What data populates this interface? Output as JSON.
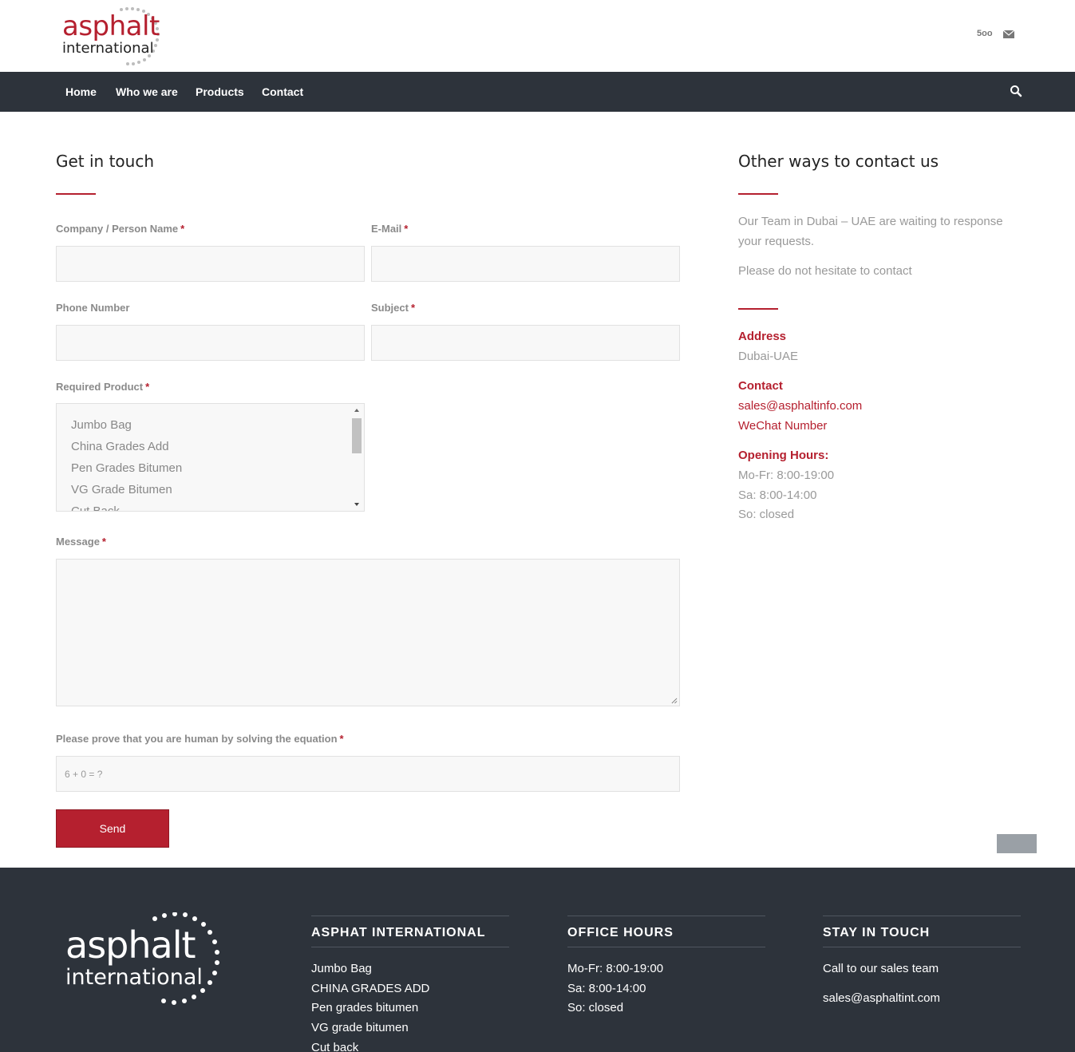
{
  "header": {
    "logo": {
      "word1": "asphalt",
      "word2": "international"
    },
    "social": {
      "icon1": "500px-icon",
      "icon1_text": "5oo",
      "icon2": "mail-icon"
    }
  },
  "nav": {
    "items": [
      "Home",
      "Who we are",
      "Products",
      "Contact"
    ],
    "search_icon": "search-icon"
  },
  "form": {
    "title": "Get in touch",
    "labels": {
      "name": "Company / Person Name",
      "email": "E-Mail",
      "phone": "Phone Number",
      "subject": "Subject",
      "product": "Required Product",
      "message": "Message",
      "captcha": "Please prove that you are human by solving the equation"
    },
    "required_mark": "*",
    "values": {
      "name": "",
      "email": "",
      "phone": "",
      "subject": "",
      "message": ""
    },
    "product_options": [
      "Jumbo Bag",
      "China Grades Add",
      "Pen Grades Bitumen",
      "VG Grade Bitumen",
      "Cut Back"
    ],
    "captcha_placeholder": "6 + 0 = ?",
    "send_label": "Send"
  },
  "sidebar": {
    "title": "Other ways to contact us",
    "intro": "Our Team in Dubai – UAE are waiting to response your requests.",
    "intro2": "Please do not hesitate to contact",
    "address_head": "Address",
    "address": "Dubai-UAE",
    "contact_head": "Contact",
    "email": "sales@asphaltinfo.com",
    "wechat": "WeChat Number",
    "hours_head": "Opening Hours:",
    "hours": [
      "Mo-Fr: 8:00-19:00",
      "Sa: 8:00-14:00",
      "So: closed"
    ]
  },
  "footer": {
    "logo": {
      "word1": "asphalt",
      "word2": "international"
    },
    "col1": {
      "title": "ASPHAT INTERNATIONAL",
      "items": [
        "Jumbo Bag",
        "CHINA GRADES ADD",
        "Pen grades bitumen",
        "VG grade bitumen",
        "Cut back"
      ]
    },
    "col2": {
      "title": "OFFICE HOURS",
      "items": [
        "Mo-Fr: 8:00-19:00",
        "Sa: 8:00-14:00",
        "So: closed"
      ]
    },
    "col3": {
      "title": "STAY IN TOUCH",
      "items": [
        "Call to our sales team",
        "sales@asphaltint.com"
      ]
    }
  },
  "colors": {
    "accent": "#b5202f",
    "nav_bg": "#2d333b",
    "field_bg": "#f8f8f8"
  }
}
